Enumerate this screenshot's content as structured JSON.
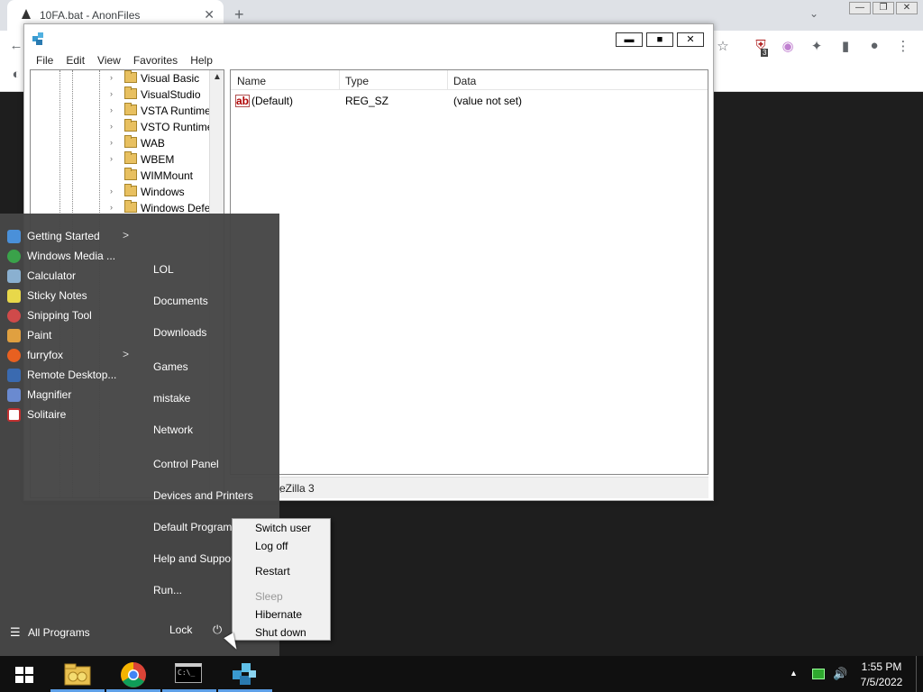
{
  "browser": {
    "tab_title": "10FA.bat - AnonFiles",
    "tab_close": "✕",
    "new_tab": "+",
    "ctrl_min": "—",
    "ctrl_restore": "❐",
    "ctrl_close": "✕",
    "back": "←",
    "star": "☆",
    "puzzle": "✦",
    "sidebar": "▮",
    "menu": "⋮",
    "ext_badge": "3",
    "tab_chevron": "⌄"
  },
  "regedit": {
    "ctrl_min": "▬",
    "ctrl_max": "■",
    "ctrl_close": "✕",
    "menu": [
      "File",
      "Edit",
      "View",
      "Favorites",
      "Help"
    ],
    "tree_items": [
      "Visual Basic",
      "VisualStudio",
      "VSTA Runtime",
      "VSTO Runtime",
      "WAB",
      "WBEM",
      "WIMMount",
      "Windows",
      "Windows Defe"
    ],
    "columns": [
      "Name",
      "Type",
      "Data"
    ],
    "row": {
      "name": "(Default)",
      "type": "REG_SZ",
      "data": "(value not set)"
    },
    "status": "eZilla 3",
    "ab_icon": "ab"
  },
  "start_menu": {
    "programs": [
      {
        "label": "Getting Started",
        "arrow": ">",
        "color": "#4a90d9"
      },
      {
        "label": "Windows Media ...",
        "arrow": "",
        "color": "#3aa24a"
      },
      {
        "label": "Calculator",
        "arrow": "",
        "color": "#8ab0d0"
      },
      {
        "label": "Sticky Notes",
        "arrow": "",
        "color": "#e8d84a"
      },
      {
        "label": "Snipping Tool",
        "arrow": "",
        "color": "#d04a4a"
      },
      {
        "label": "Paint",
        "arrow": "",
        "color": "#e0a040"
      },
      {
        "label": "furryfox",
        "arrow": ">",
        "color": "#e86020"
      },
      {
        "label": "Remote Desktop...",
        "arrow": "",
        "color": "#3a6ab0"
      },
      {
        "label": "Magnifier",
        "arrow": "",
        "color": "#6a8ad0"
      },
      {
        "label": "Solitaire",
        "arrow": "",
        "color": "#c03030"
      }
    ],
    "all_programs": "All Programs",
    "places": [
      "LOL",
      "Documents",
      "Downloads",
      "Games",
      "mistake",
      "Network",
      "Control Panel",
      "Devices and Printers",
      "Default Programs",
      "Help and Support",
      "Run..."
    ],
    "lock": "Lock",
    "power_glyph": "⏻",
    "list_glyph": "☰"
  },
  "power_menu": {
    "items": [
      "Switch user",
      "Log off",
      "Restart",
      "Sleep",
      "Hibernate",
      "Shut down"
    ]
  },
  "taskbar": {
    "time": "1:55 PM",
    "date": "7/5/2022",
    "cmd_label": "C:\\_",
    "tray_up": "▲",
    "volume": "🔊"
  }
}
